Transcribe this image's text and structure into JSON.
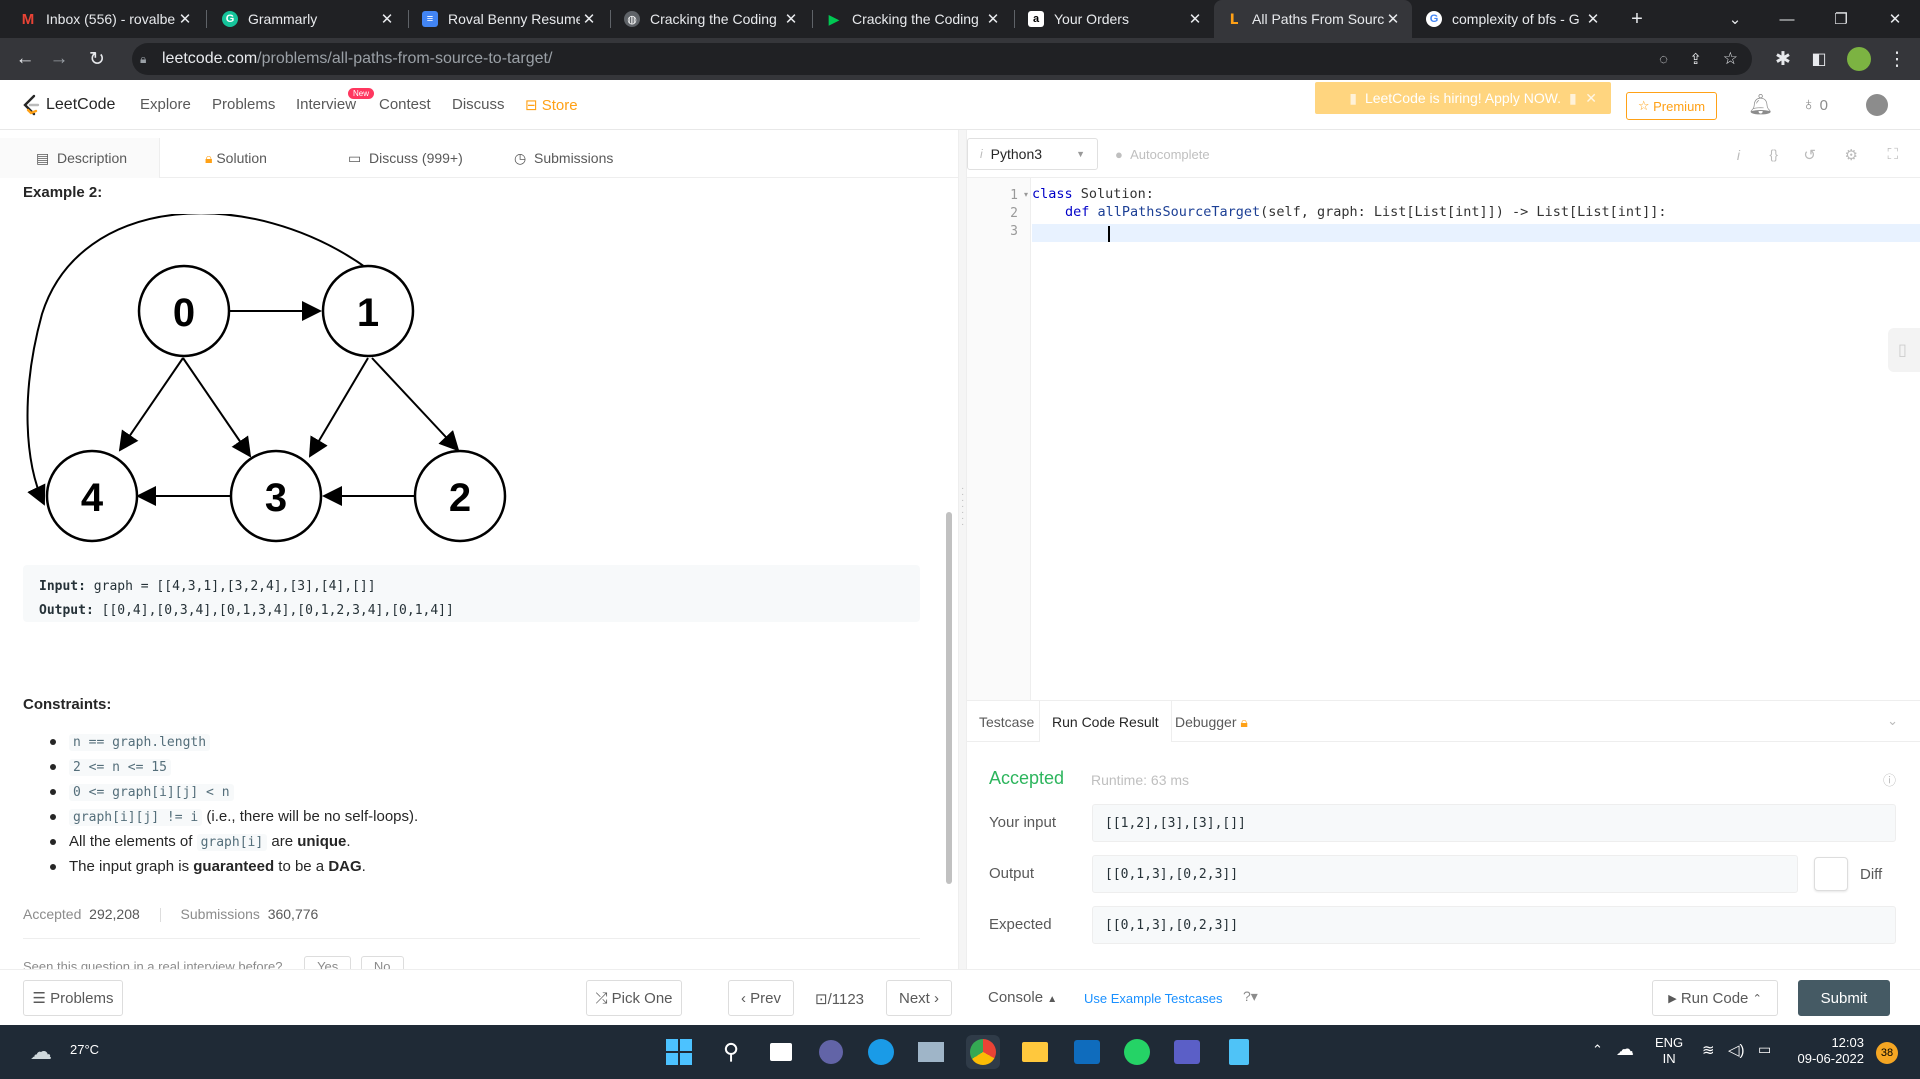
{
  "browser": {
    "tabs": [
      {
        "title": "Inbox (556) - rovalbe",
        "icon": "gmail-icon",
        "color": "#ea4335",
        "glyph": "M"
      },
      {
        "title": "Grammarly",
        "icon": "grammarly-icon",
        "color": "#15c39a",
        "glyph": "G"
      },
      {
        "title": "Roval Benny Resume",
        "icon": "docs-icon",
        "color": "#4285f4",
        "glyph": "≡"
      },
      {
        "title": "Cracking the Coding",
        "icon": "globe-icon",
        "color": "#5f6368",
        "glyph": "◍"
      },
      {
        "title": "Cracking the Coding",
        "icon": "play-icon",
        "color": "#00c853",
        "glyph": "▶"
      },
      {
        "title": "Your Orders",
        "icon": "amazon-icon",
        "color": "#ffffff",
        "glyph": "a"
      },
      {
        "title": "All Paths From Sourc",
        "icon": "leetcode-icon",
        "color": "#ffa116",
        "glyph": "L"
      },
      {
        "title": "complexity of bfs - G",
        "icon": "google-icon",
        "color": "#ffffff",
        "glyph": "G"
      }
    ],
    "new_tab_label": "+",
    "url_main": "leetcode.com",
    "url_path": "/problems/all-paths-from-source-to-target/"
  },
  "nav": {
    "logo_text": "LeetCode",
    "links": [
      "Explore",
      "Problems",
      "Interview",
      "Contest",
      "Discuss"
    ],
    "new_badge": "New",
    "store": "Store",
    "hiring_banner": "LeetCode is hiring! Apply NOW.",
    "premium": "Premium",
    "streak_count": "0"
  },
  "left_tabs": [
    "Description",
    "Solution",
    "Discuss (999+)",
    "Submissions"
  ],
  "description": {
    "example_heading": "Example 2:",
    "graph_nodes": [
      "0",
      "1",
      "2",
      "3",
      "4"
    ],
    "input_label": "Input:",
    "input_value": "graph = [[4,3,1],[3,2,4],[3],[4],[]]",
    "output_label": "Output:",
    "output_value": "[[0,4],[0,3,4],[0,1,3,4],[0,1,2,3,4],[0,1,4]]",
    "constraints_heading": "Constraints:",
    "constraints": [
      {
        "code": "n == graph.length"
      },
      {
        "code": "2 <= n <= 15"
      },
      {
        "code": "0 <= graph[i][j] < n"
      },
      {
        "code": "graph[i][j] != i",
        "text": "(i.e., there will be no self-loops)."
      },
      {
        "pre": "All the elements of",
        "code": "graph[i]",
        "post": "are",
        "bold": "unique",
        "end": "."
      },
      {
        "pre": "The input graph is",
        "bold": "guaranteed",
        "post": "to be a",
        "bold2": "DAG",
        "end": "."
      }
    ],
    "accepted_label": "Accepted",
    "accepted_value": "292,208",
    "submissions_label": "Submissions",
    "submissions_value": "360,776",
    "seen_question": "Seen this question in a real interview before?",
    "yes": "Yes",
    "no": "No"
  },
  "editor": {
    "language": "Python3",
    "autocomplete": "Autocomplete",
    "line_numbers": [
      "1",
      "2",
      "3"
    ],
    "code_line1_kw": "class",
    "code_line1_rest": "Solution:",
    "code_line2_kw": "def",
    "code_line2_fn": "allPathsSourceTarget",
    "code_line2_args": "(self, graph: List[List[int]]) -> List[List[int]]:"
  },
  "result_tabs": [
    "Testcase",
    "Run Code Result",
    "Debugger"
  ],
  "result": {
    "status": "Accepted",
    "runtime": "Runtime: 63 ms",
    "your_input_label": "Your input",
    "your_input": "[[1,2],[3],[3],[]]",
    "output_label": "Output",
    "output": "[[0,1,3],[0,2,3]]",
    "diff": "Diff",
    "expected_label": "Expected",
    "expected": "[[0,1,3],[0,2,3]]"
  },
  "bottom": {
    "problems": "Problems",
    "pick_one": "Pick One",
    "prev": "Prev",
    "page": "/1123",
    "next": "Next",
    "console": "Console",
    "use_example": "Use Example Testcases",
    "run_code": "Run Code",
    "submit": "Submit"
  },
  "taskbar": {
    "weather": "27°C",
    "lang1": "ENG",
    "lang2": "IN",
    "time": "12:03",
    "date": "09-06-2022",
    "notif": "38"
  },
  "colors": {
    "accepted_green": "#2db55d",
    "leetcode_orange": "#ffa116",
    "submit_bg": "#455a64"
  }
}
